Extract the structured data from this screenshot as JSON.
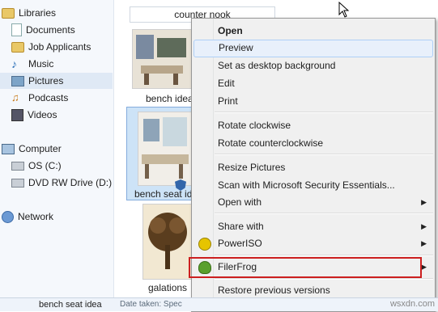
{
  "nav": {
    "items": [
      {
        "label": "Libraries",
        "icon": "libraries-icon"
      },
      {
        "label": "Documents",
        "icon": "documents-icon"
      },
      {
        "label": "Job Applicants",
        "icon": "folder-icon"
      },
      {
        "label": "Music",
        "icon": "music-icon"
      },
      {
        "label": "Pictures",
        "icon": "pictures-icon"
      },
      {
        "label": "Podcasts",
        "icon": "podcasts-icon"
      },
      {
        "label": "Videos",
        "icon": "videos-icon"
      },
      {
        "label": "Computer",
        "icon": "computer-icon"
      },
      {
        "label": "OS (C:)",
        "icon": "drive-icon"
      },
      {
        "label": "DVD RW Drive (D:) A",
        "icon": "dvd-drive-icon"
      },
      {
        "label": "Network",
        "icon": "network-icon"
      }
    ]
  },
  "content": {
    "header_label": "counter nook",
    "thumbs": [
      {
        "label": "bench idea"
      },
      {
        "label": "bench seat id"
      },
      {
        "label": "galations"
      }
    ]
  },
  "menu": {
    "items": [
      {
        "label": "Open"
      },
      {
        "label": "Preview"
      },
      {
        "label": "Set as desktop background"
      },
      {
        "label": "Edit"
      },
      {
        "label": "Print"
      },
      {
        "label": "Rotate clockwise"
      },
      {
        "label": "Rotate counterclockwise"
      },
      {
        "label": "Resize Pictures"
      },
      {
        "label": "Scan with Microsoft Security Essentials..."
      },
      {
        "label": "Open with"
      },
      {
        "label": "Share with"
      },
      {
        "label": "PowerISO"
      },
      {
        "label": "FilerFrog"
      },
      {
        "label": "Restore previous versions"
      }
    ]
  },
  "status": {
    "filename": "bench seat idea",
    "meta": "Date taken: Spec"
  },
  "watermark": "wsxdn.com",
  "colors": {
    "highlight_border": "#cc1f1f",
    "selection": "#cde3f7",
    "menu_hover": "#e8f0fb"
  }
}
